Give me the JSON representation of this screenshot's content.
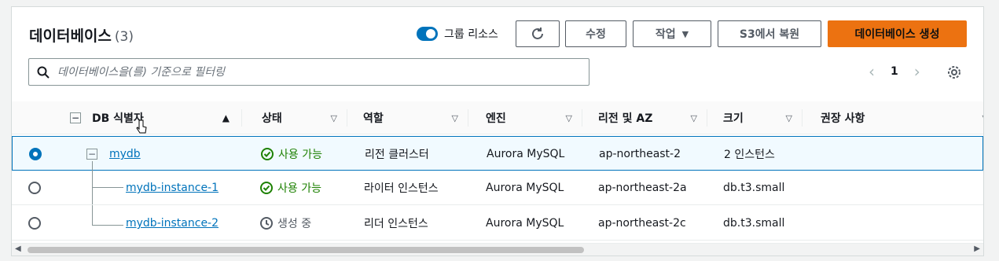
{
  "header": {
    "title": "데이터베이스",
    "count": "(3)",
    "group_toggle_label": "그룹 리소스",
    "buttons": {
      "refresh_icon": "refresh-icon",
      "modify": "수정",
      "actions": "작업",
      "restore_s3": "S3에서 복원",
      "create": "데이터베이스 생성"
    }
  },
  "search": {
    "placeholder": "데이터베이스을(를) 기준으로 필터링",
    "value": ""
  },
  "pagination": {
    "current_page": "1"
  },
  "table": {
    "columns": [
      "DB 식별자",
      "상태",
      "역할",
      "엔진",
      "리전 및 AZ",
      "크기",
      "권장 사항"
    ],
    "rows": [
      {
        "id": "mydb",
        "status": "사용 가능",
        "role": "리전 클러스터",
        "engine": "Aurora MySQL",
        "region": "ap-northeast-2",
        "size": "2 인스턴스",
        "recommendation": ""
      },
      {
        "id": "mydb-instance-1",
        "status": "사용 가능",
        "role": "라이터 인스턴스",
        "engine": "Aurora MySQL",
        "region": "ap-northeast-2a",
        "size": "db.t3.small",
        "recommendation": ""
      },
      {
        "id": "mydb-instance-2",
        "status": "생성 중",
        "role": "리더 인스턴스",
        "engine": "Aurora MySQL",
        "region": "ap-northeast-2c",
        "size": "db.t3.small",
        "recommendation": ""
      }
    ]
  },
  "colors": {
    "accent": "#0073bb",
    "primary_button": "#ec7211",
    "success": "#1d8102"
  }
}
